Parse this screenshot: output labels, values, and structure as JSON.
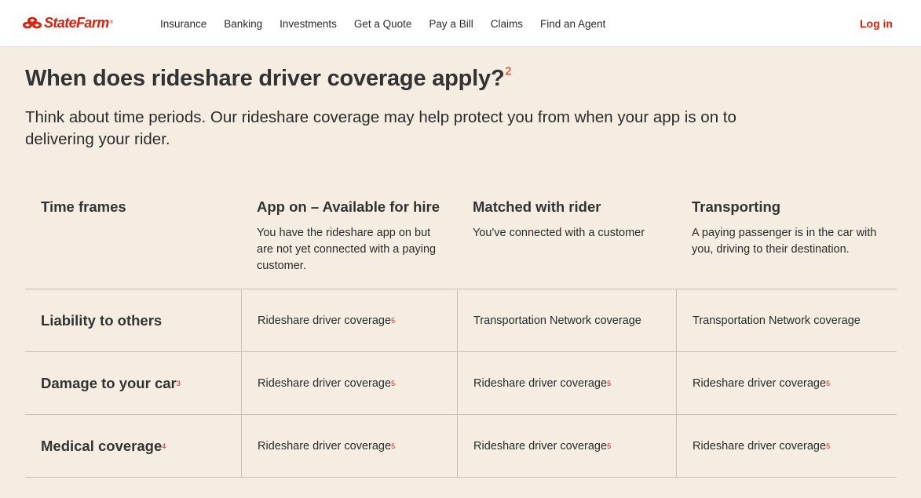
{
  "brand": {
    "name": "StateFarm",
    "registered": "®",
    "color": "#d62311"
  },
  "nav": {
    "items": [
      "Insurance",
      "Banking",
      "Investments",
      "Get a Quote",
      "Pay a Bill",
      "Claims",
      "Find an Agent"
    ],
    "login": "Log in"
  },
  "page": {
    "title": "When does rideshare driver coverage apply?",
    "title_sup": "2",
    "intro": "Think about time periods. Our rideshare coverage may help protect you from when your app is on to delivering your rider."
  },
  "table": {
    "headers": [
      {
        "title": "Time frames",
        "desc": ""
      },
      {
        "title": "App on – Available for hire",
        "desc": "You have the rideshare app on but are not yet connected with a paying customer."
      },
      {
        "title": "Matched with rider",
        "desc": "You've connected with a customer"
      },
      {
        "title": "Transporting",
        "desc": "A paying passenger is in the car with you, driving to their destination."
      }
    ],
    "rows": [
      {
        "label": "Liability to others",
        "label_sup": "",
        "cells": [
          {
            "text": "Rideshare driver coverage",
            "sup": "5"
          },
          {
            "text": "Transportation Network coverage",
            "sup": ""
          },
          {
            "text": "Transportation Network coverage",
            "sup": ""
          }
        ]
      },
      {
        "label": "Damage to your car",
        "label_sup": "3",
        "cells": [
          {
            "text": "Rideshare driver coverage",
            "sup": "5"
          },
          {
            "text": "Rideshare driver coverage",
            "sup": "5"
          },
          {
            "text": "Rideshare driver coverage",
            "sup": "5"
          }
        ]
      },
      {
        "label": "Medical coverage",
        "label_sup": "4",
        "cells": [
          {
            "text": "Rideshare driver coverage",
            "sup": "5"
          },
          {
            "text": "Rideshare driver coverage",
            "sup": "5"
          },
          {
            "text": "Rideshare driver coverage",
            "sup": "5"
          }
        ]
      }
    ]
  }
}
